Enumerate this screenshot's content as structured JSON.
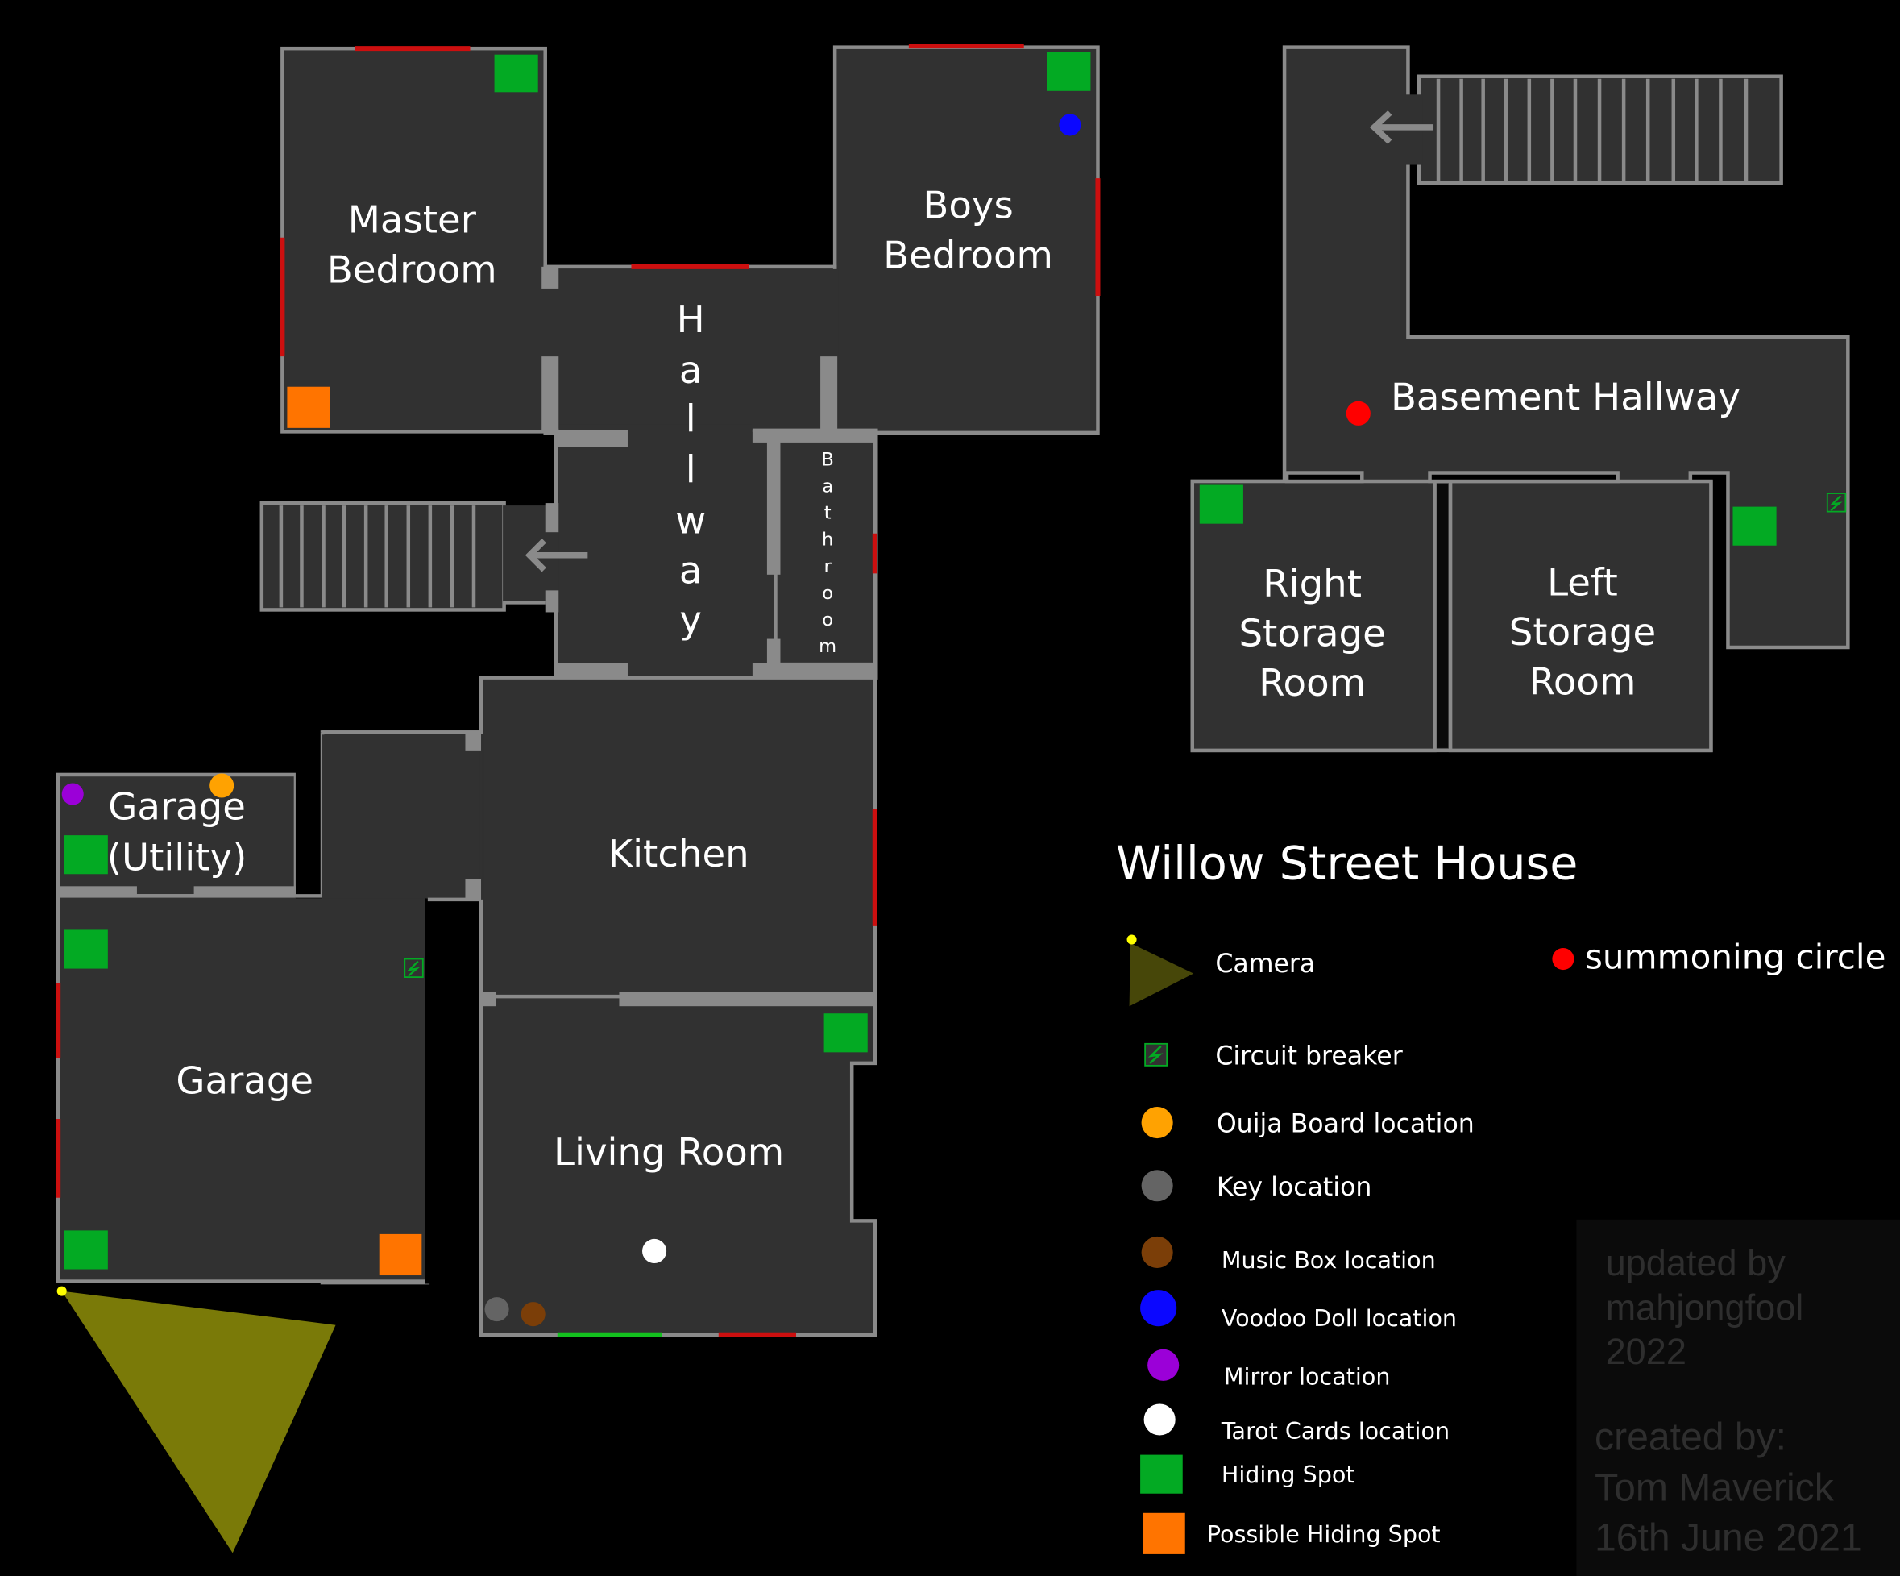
{
  "title": "Willow Street House",
  "rooms": {
    "master_bedroom": [
      "Master",
      "Bedroom"
    ],
    "boys_bedroom": [
      "Boys",
      "Bedroom"
    ],
    "hallway": [
      "H",
      "a",
      "l",
      "l",
      "w",
      "a",
      "y"
    ],
    "bathroom": [
      "B",
      "a",
      "t",
      "h",
      "r",
      "o",
      "o",
      "m"
    ],
    "garage_utility": [
      "Garage",
      "(Utility)"
    ],
    "garage": "Garage",
    "kitchen": "Kitchen",
    "living_room": "Living Room",
    "basement_hallway": "Basement Hallway",
    "right_storage": [
      "Right",
      "Storage",
      "Room"
    ],
    "left_storage": [
      "Left",
      "Storage",
      "Room"
    ]
  },
  "legend": {
    "camera": "Camera",
    "circuit_breaker": "Circuit breaker",
    "ouija": "Ouija Board location",
    "key": "Key location",
    "music_box": "Music Box location",
    "voodoo": "Voodoo Doll location",
    "mirror": "Mirror location",
    "tarot": "Tarot Cards location",
    "hiding_spot": "Hiding Spot",
    "possible_hiding_spot": "Possible Hiding Spot",
    "summoning_circle": "summoning circle"
  },
  "colors": {
    "hiding_spot": "#03aa23",
    "possible_hiding_spot": "#ff7400",
    "ouija": "#ffa201",
    "key": "#646464",
    "music_box": "#7b3e08",
    "voodoo": "#0b07ff",
    "mirror": "#9b00d8",
    "tarot": "#ffffff",
    "summoning_circle": "#ff0000",
    "camera_cone": "#7a7a08",
    "camera_dot": "#ffff00",
    "door": "#cc0f0f",
    "front_door": "#13c01e"
  },
  "credits": {
    "updated": [
      "updated by",
      "mahjongfool",
      "2022"
    ],
    "created": [
      "created by:",
      "Tom Maverick",
      "16th June 2021"
    ]
  }
}
